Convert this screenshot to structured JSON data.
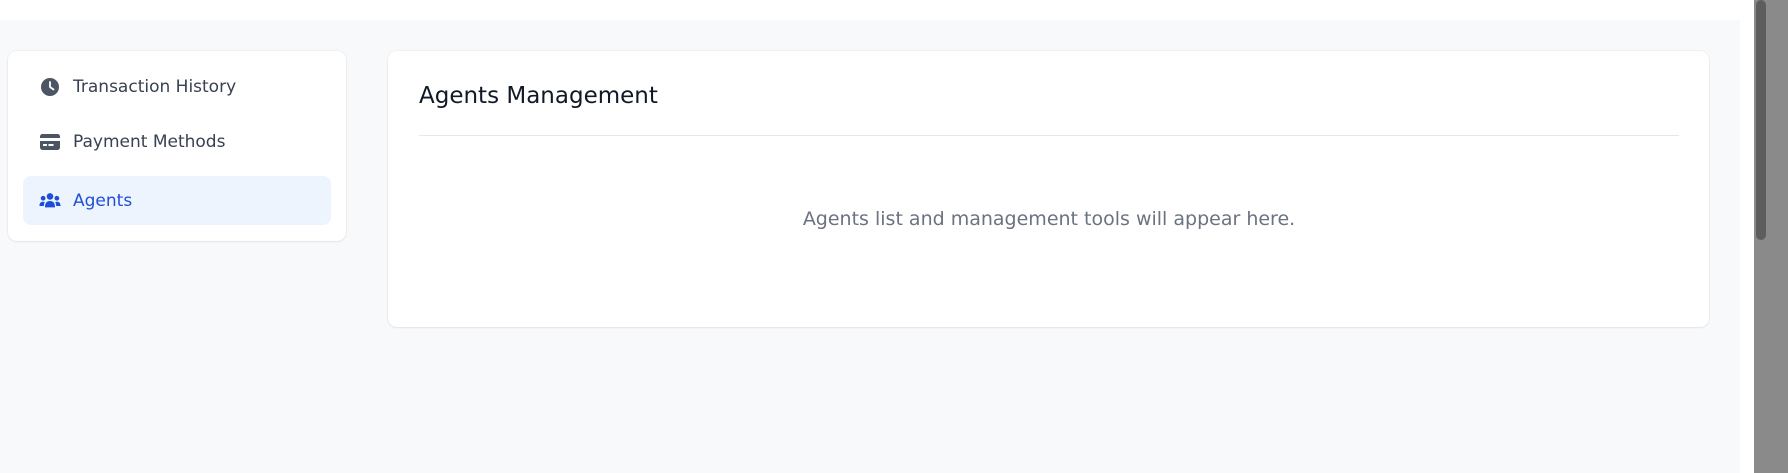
{
  "sidebar": {
    "items": [
      {
        "label": "Transaction History",
        "icon": "clock-icon",
        "active": false
      },
      {
        "label": "Payment Methods",
        "icon": "credit-card-icon",
        "active": false
      },
      {
        "label": "Agents",
        "icon": "users-icon",
        "active": true
      }
    ]
  },
  "main": {
    "title": "Agents Management",
    "empty_message": "Agents list and management tools will appear here."
  },
  "colors": {
    "accent": "#1d4ed8",
    "active_bg": "#eef4fe",
    "page_bg": "#f8f9fb"
  }
}
